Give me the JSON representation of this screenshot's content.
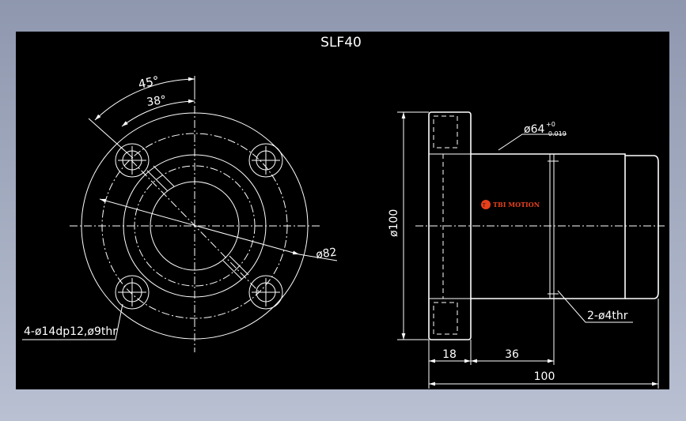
{
  "drawing": {
    "title": "SLF40",
    "angle_outer": "45°",
    "angle_inner": "38°",
    "dia_82": "ø82",
    "holes_note": "4-ø14dp12,ø9thr",
    "dia_100": "ø100",
    "dia_64": "ø64",
    "tol_upper": "+0",
    "tol_lower": "-0.019",
    "pilot_holes": "2-ø4thr",
    "dim_18": "18",
    "dim_36": "36",
    "dim_100": "100",
    "logo_text": "TBI MOTION"
  },
  "colors": {
    "background": "#000000",
    "lines": "#ffffff",
    "logo": "#e8401c"
  }
}
